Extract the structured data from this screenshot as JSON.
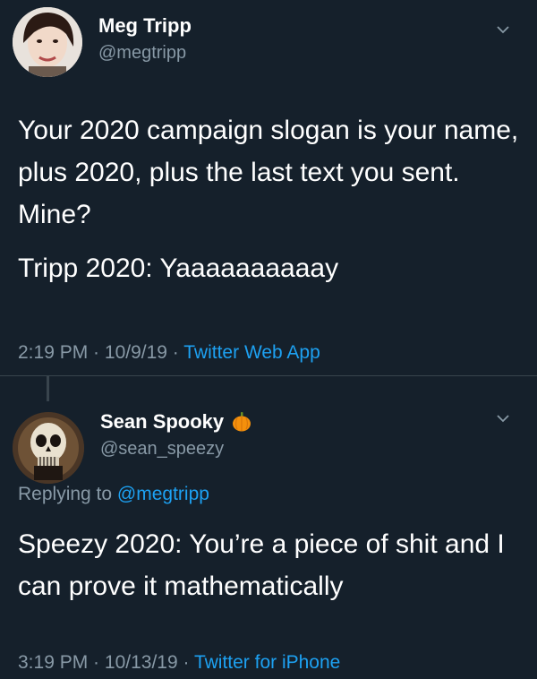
{
  "tweet1": {
    "display_name": "Meg Tripp",
    "handle": "@megtripp",
    "text": "Your 2020 campaign slogan is your name, plus 2020, plus the last text you sent. Mine?",
    "text_2": "Tripp 2020: Yaaaaaaaaaay",
    "time": "2:19 PM",
    "date": "10/9/19",
    "separator": " · ",
    "source": "Twitter Web App"
  },
  "tweet2": {
    "display_name": "Sean Spooky",
    "handle": "@sean_speezy",
    "replying_label": "Replying to ",
    "replying_mention": "@megtripp",
    "text": "Speezy 2020: You’re a piece of shit and I can prove it mathematically",
    "time": "3:19 PM",
    "date": "10/13/19",
    "separator": " · ",
    "source": "Twitter for iPhone",
    "name_emoji": "pumpkin-icon"
  },
  "colors": {
    "background": "#15202b",
    "primary_text": "#ffffff",
    "secondary_text": "#8899a6",
    "link": "#1da1f2",
    "divider": "#38444d"
  }
}
